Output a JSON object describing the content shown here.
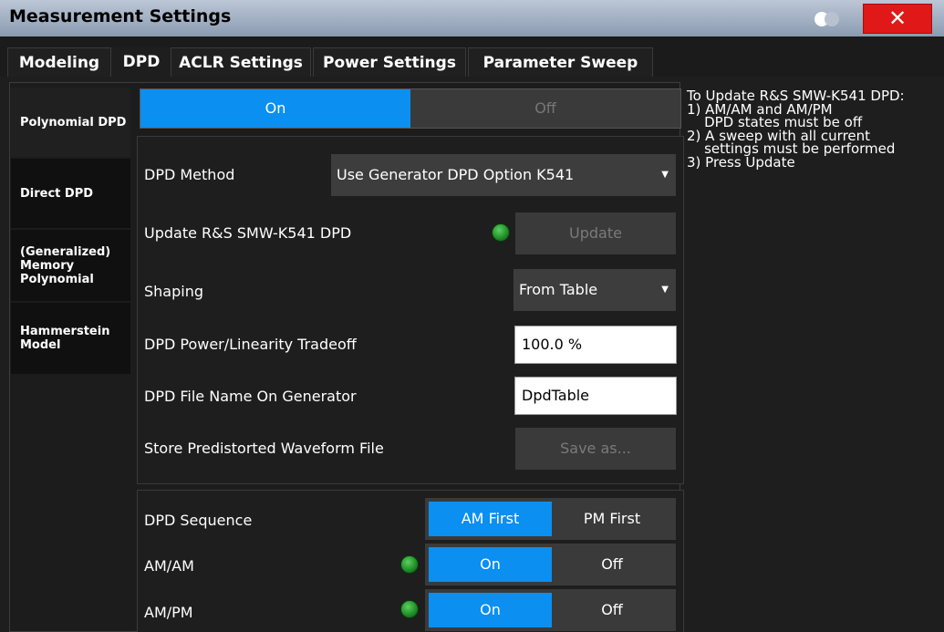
{
  "window": {
    "title": "Measurement Settings",
    "close_label": "✕"
  },
  "tabs": [
    "Modeling",
    "DPD",
    "ACLR Settings",
    "Power Settings",
    "Parameter Sweep"
  ],
  "subtabs": [
    "Polynomial DPD",
    "Direct DPD",
    "(Generalized) Memory Polynomial",
    "Hammerstein Model"
  ],
  "dpd_state": {
    "on": "On",
    "off": "Off",
    "selected": "On"
  },
  "fields": {
    "dpd_method_label": "DPD Method",
    "dpd_method_value": "Use Generator DPD Option K541",
    "update_label": "Update R&S SMW-K541 DPD",
    "update_button": "Update",
    "shaping_label": "Shaping",
    "shaping_value": "From Table",
    "tradeoff_label": "DPD Power/Linearity Tradeoff",
    "tradeoff_value": "100.0 %",
    "filename_label": "DPD File Name On Generator",
    "filename_value": "DpdTable",
    "store_label": "Store Predistorted Waveform File",
    "store_button": "Save as..."
  },
  "sequence": {
    "label": "DPD Sequence",
    "am_first": "AM First",
    "pm_first": "PM First",
    "selected": "AM First"
  },
  "amam": {
    "label": "AM/AM",
    "on": "On",
    "off": "Off"
  },
  "ampm": {
    "label": "AM/PM",
    "on": "On",
    "off": "Off"
  },
  "help_text": "To Update R&S SMW-K541 DPD:\n1) AM/AM and AM/PM\n    DPD states must be off\n2) A sweep with all current\n    settings must be performed\n3) Press Update",
  "colors": {
    "accent": "#0b8ff0",
    "close": "#e01818",
    "led": "#2fb035"
  }
}
